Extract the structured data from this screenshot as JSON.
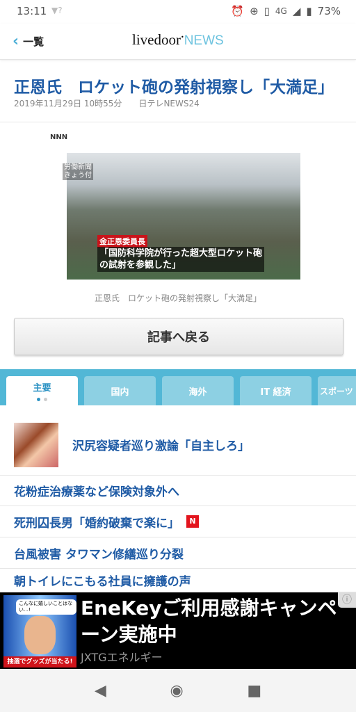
{
  "status": {
    "time": "13:11",
    "network": "4G",
    "battery": "73%",
    "icons": [
      "wifi-unknown-icon",
      "alarm-icon",
      "data-saver-icon",
      "vibrate-icon",
      "signal-icon",
      "battery-icon"
    ]
  },
  "header": {
    "back_label": "一覧",
    "logo_main": "livedoor",
    "logo_sub": "NEWS"
  },
  "article": {
    "title": "正恩氏　ロケット砲の発射視察し「大満足」",
    "date": "2019年11月29日 10時55分",
    "source": "日テレNEWS24",
    "photo": {
      "logo": "NNN",
      "source_label": "労働新聞\nきょう付",
      "name_label": "金正恩委員長",
      "caption": "「国防科学院が行った超大型ロケット砲の試射を参観した」"
    },
    "image_caption": "正恩氏　ロケット砲の発射視察し「大満足」",
    "back_button": "記事へ戻る"
  },
  "tabs": [
    {
      "label": "主要",
      "active": true
    },
    {
      "label": "国内"
    },
    {
      "label": "海外"
    },
    {
      "label": "IT 経済"
    },
    {
      "label": "スポーツ"
    }
  ],
  "news": [
    {
      "title": "沢尻容疑者巡り激論「自主しろ」",
      "has_thumb": true
    },
    {
      "title": "花粉症治療薬など保険対象外へ"
    },
    {
      "title": "死刑囚長男「婚約破棄で楽に」",
      "badge": "N"
    },
    {
      "title": "台風被害 タワマン修繕巡り分裂"
    },
    {
      "title": "朝トイレにこもる社員に擁護の声"
    }
  ],
  "ad": {
    "headline": "EneKeyご利用感謝キャンペーン実施中",
    "advertiser": "JXTGエネルギー",
    "bubble": "こんなに嬉しいことはない…!",
    "promo": "抽選でグッズが当たる!"
  },
  "colors": {
    "accent": "#1f5ba5",
    "tab_band": "#52b7d6",
    "badge": "#e3141d"
  }
}
